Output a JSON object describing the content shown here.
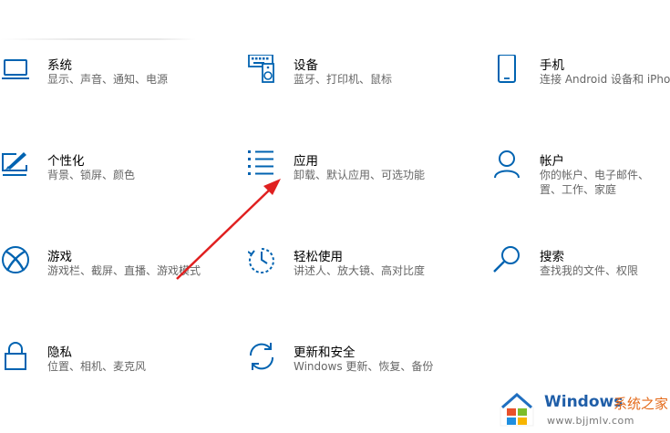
{
  "tiles": {
    "system": {
      "title": "系统",
      "desc": "显示、声音、通知、电源",
      "icon": "laptop-icon"
    },
    "devices": {
      "title": "设备",
      "desc": "蓝牙、打印机、鼠标",
      "icon": "keyboard-speaker-icon"
    },
    "phone": {
      "title": "手机",
      "desc": "连接 Android 设备和 iPho",
      "icon": "phone-icon"
    },
    "personalization": {
      "title": "个性化",
      "desc": "背景、锁屏、颜色",
      "icon": "paint-monitor-icon"
    },
    "apps": {
      "title": "应用",
      "desc": "卸载、默认应用、可选功能",
      "icon": "app-list-icon"
    },
    "accounts": {
      "title": "帐户",
      "desc_line1": "你的帐户、电子邮件、",
      "desc_line2": "置、工作、家庭",
      "icon": "person-icon"
    },
    "gaming": {
      "title": "游戏",
      "desc": "游戏栏、截屏、直播、游戏模式",
      "icon": "xbox-icon"
    },
    "ease": {
      "title": "轻松使用",
      "desc": "讲述人、放大镜、高对比度",
      "icon": "ease-of-access-icon"
    },
    "search": {
      "title": "搜索",
      "desc": "查找我的文件、权限",
      "icon": "magnifier-icon"
    },
    "privacy": {
      "title": "隐私",
      "desc": "位置、相机、麦克风",
      "icon": "lock-icon"
    },
    "update": {
      "title": "更新和安全",
      "desc": "Windows 更新、恢复、备份",
      "icon": "sync-icon"
    }
  },
  "watermark": {
    "brand": "Windows",
    "brand_cn": "系统之家",
    "url": "www.bjjmlv.com"
  },
  "colors": {
    "accent": "#0063b1",
    "arrow": "#e02020",
    "desc_text": "#666666"
  }
}
